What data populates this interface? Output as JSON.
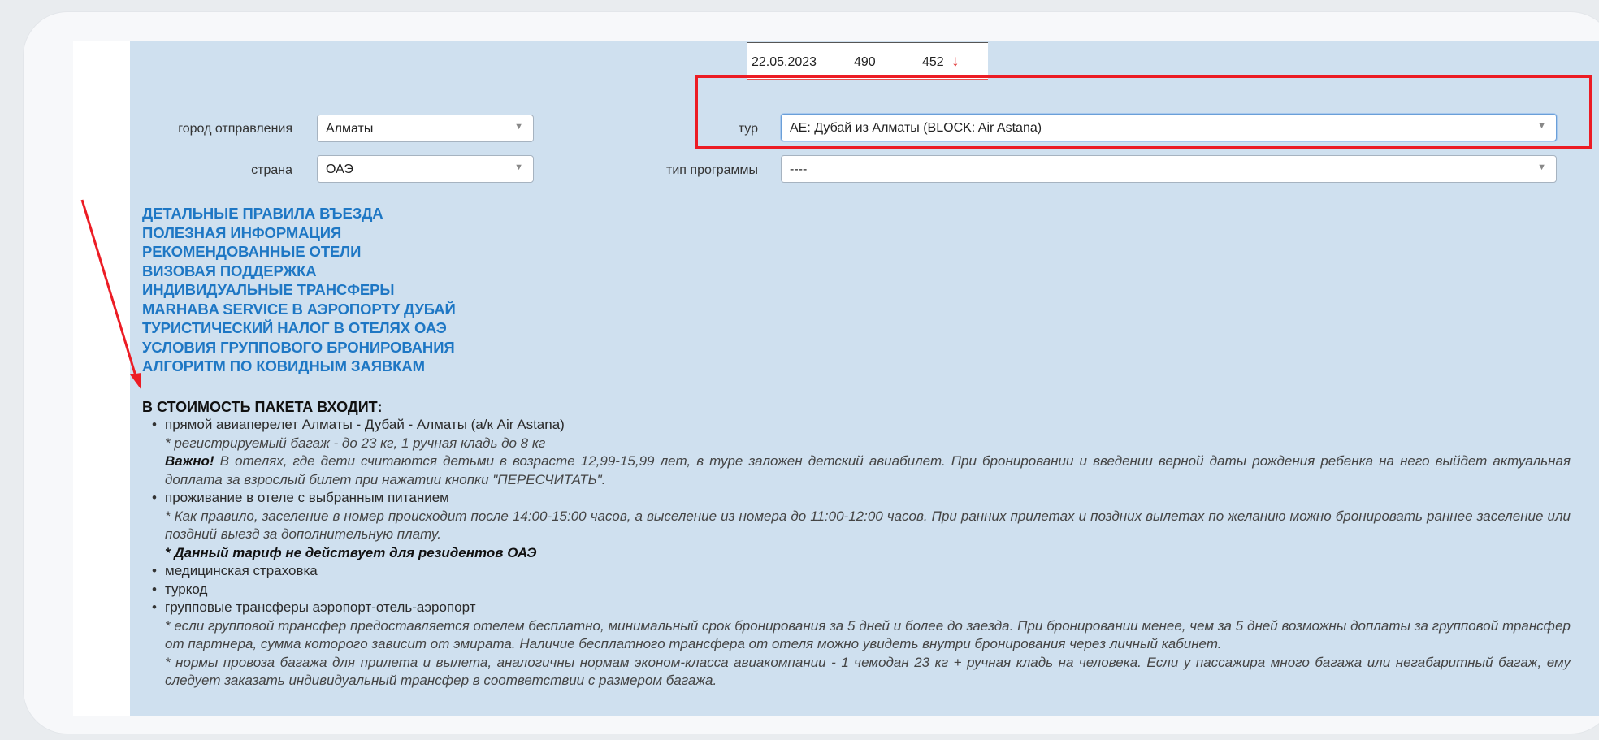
{
  "price_row": {
    "date": "22.05.2023",
    "old_price": "490",
    "new_price": "452",
    "trend_arrow": "↓",
    "trend_color": "#e03030"
  },
  "form": {
    "departure_city_label": "город отправления",
    "departure_city_value": "Алматы",
    "country_label": "страна",
    "country_value": "ОАЭ",
    "tour_label": "тур",
    "tour_value": "AE: Дубай из Алматы (BLOCK: Air Astana)",
    "program_type_label": "тип программы",
    "program_type_value": "----"
  },
  "links": [
    "ДЕТАЛЬНЫЕ ПРАВИЛА ВЪЕЗДА",
    "ПОЛЕЗНАЯ ИНФОРМАЦИЯ",
    "РЕКОМЕНДОВАННЫЕ ОТЕЛИ",
    "ВИЗОВАЯ ПОДДЕРЖКА",
    "ИНДИВИДУАЛЬНЫЕ ТРАНСФЕРЫ",
    "MARHABA SERVICE В АЭРОПОРТУ ДУБАЙ",
    "ТУРИСТИЧЕСКИЙ НАЛОГ В ОТЕЛЯХ ОАЭ",
    "УСЛОВИЯ ГРУППОВОГО БРОНИРОВАНИЯ",
    "АЛГОРИТМ ПО КОВИДНЫМ ЗАЯВКАМ"
  ],
  "package": {
    "heading": "В СТОИМОСТЬ ПАКЕТА ВХОДИТ:",
    "item1": "прямой авиаперелет Алматы - Дубай - Алматы (а/к Air Astana)",
    "item1_note1": "* регистрируемый багаж - до 23 кг, 1 ручная кладь до 8 кг",
    "item1_note2_bold": "Важно!",
    "item1_note2": " В отелях, где дети считаются детьми в возрасте 12,99-15,99 лет, в туре заложен детский авиабилет. При бронировании и введении верной даты рождения ребенка на него выйдет актуальная доплата за взрослый билет при нажатии кнопки \"ПЕРЕСЧИТАТЬ\".",
    "item2": "проживание в отеле с выбранным питанием",
    "item2_note1": "* Как правило, заселение в номер происходит после 14:00-15:00 часов, а выселение из номера до 11:00-12:00 часов. При ранних прилетах и поздних вылетах по желанию можно бронировать раннее заселение или поздний выезд за дополнительную плату.",
    "item2_note2": "* Данный тариф не действует для резидентов ОАЭ",
    "item3": "медицинская страховка",
    "item4": "туркод",
    "item5": "групповые трансферы аэропорт-отель-аэропорт",
    "item5_note1": "* если групповой трансфер предоставляется отелем бесплатно, минимальный срок бронирования за 5 дней и более до заезда. При бронировании менее, чем за 5 дней возможны доплаты за групповой трансфер от партнера, сумма которого зависит от эмирата. Наличие бесплатного трансфера от отеля можно увидеть внутри бронирования через личный кабинет.",
    "item5_note2": "*  нормы провоза багажа для прилета и вылета, аналогичны нормам эконом-класса авиакомпании - 1 чемодан 23 кг + ручная кладь на человека. Если у пассажира много багажа или негабаритный багаж, ему следует заказать индивидуальный трансфер в соответствии с размером багажа."
  },
  "colors": {
    "panel_bg": "#cfe0ef",
    "link_color": "#1e77c4",
    "annotation_red": "#ec1c24"
  },
  "icons": {
    "dropdown": "chevron-down-icon",
    "annotation_arrow": "red-arrow-icon"
  }
}
